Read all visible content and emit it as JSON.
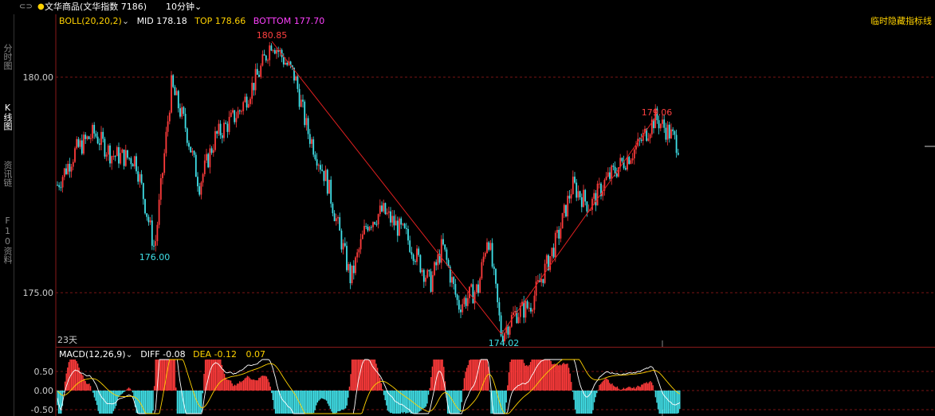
{
  "window": {
    "toolbar_icon": "⊂⊃",
    "instrument": "文华商品(文华指数 7186)",
    "period": "10分钟"
  },
  "left_tabs": [
    {
      "label": "分时图",
      "active": false
    },
    {
      "label": "K线图",
      "active": true
    },
    {
      "label": "资讯链",
      "active": false
    },
    {
      "label": "F10资料",
      "active": false
    }
  ],
  "main_panel": {
    "indicator": "BOLL(20,20,2)",
    "mid_label": "MID",
    "mid_value": "178.18",
    "top_label": "TOP",
    "top_value": "178.66",
    "bottom_label": "BOTTOM",
    "bottom_value": "177.70",
    "hide_link": "临时隐藏指标线",
    "y_ticks": [
      "180.00",
      "175.00"
    ],
    "days_label": "23天",
    "annotations": {
      "high1": "180.85",
      "low1": "176.00",
      "low2": "174.02",
      "high2": "179.06"
    },
    "colors": {
      "up": "#ff3b3b",
      "down": "#40e0e8",
      "mid": "#ffffff",
      "top": "#ffd200",
      "bottom": "#ff40ff"
    }
  },
  "macd_panel": {
    "indicator": "MACD(12,26,9)",
    "diff_label": "DIFF",
    "diff_value": "-0.08",
    "dea_label": "DEA",
    "dea_value": "-0.12",
    "macd_value": "0.07",
    "y_ticks": [
      "0.50",
      "0.00",
      "-0.50"
    ]
  }
}
